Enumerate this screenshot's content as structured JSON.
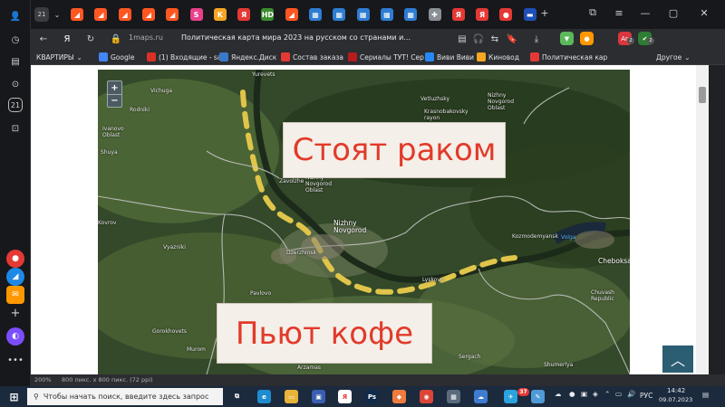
{
  "tabstrip": {
    "profile_counter": "21",
    "tabs": [
      {
        "icon": "yandex-zen-icon",
        "color": "#ff5722",
        "glyph": "◢"
      },
      {
        "icon": "yandex-zen-icon",
        "color": "#ff5722",
        "glyph": "◢"
      },
      {
        "icon": "yandex-zen-icon",
        "color": "#ff5722",
        "glyph": "◢"
      },
      {
        "icon": "yandex-zen-icon",
        "color": "#ff5722",
        "glyph": "◢"
      },
      {
        "icon": "yandex-zen-icon",
        "color": "#ff5722",
        "glyph": "◢"
      },
      {
        "icon": "s-site-icon",
        "color": "#e8418c",
        "glyph": "S"
      },
      {
        "icon": "kinovod-icon",
        "color": "#f5a623",
        "glyph": "K"
      },
      {
        "icon": "yandex-icon",
        "color": "#e53935",
        "glyph": "Я"
      },
      {
        "icon": "hd-site-icon",
        "color": "#3c8d2f",
        "glyph": "HD"
      },
      {
        "icon": "yandex-zen-icon",
        "color": "#ff5722",
        "glyph": "◢"
      },
      {
        "icon": "windows-icon",
        "color": "#2d7dd2",
        "glyph": "▦"
      },
      {
        "icon": "windows-icon",
        "color": "#2d7dd2",
        "glyph": "▦"
      },
      {
        "icon": "windows-icon",
        "color": "#2d7dd2",
        "glyph": "▦"
      },
      {
        "icon": "windows-icon",
        "color": "#2d7dd2",
        "glyph": "▦"
      },
      {
        "icon": "windows-icon",
        "color": "#2d7dd2",
        "glyph": "▦"
      },
      {
        "icon": "puzzle-icon",
        "color": "#8a8f96",
        "glyph": "✚"
      },
      {
        "icon": "yandex-icon",
        "color": "#e53935",
        "glyph": "Я"
      },
      {
        "icon": "yandex-icon",
        "color": "#e53935",
        "glyph": "Я"
      },
      {
        "icon": "map-pin-icon",
        "color": "#e53935",
        "glyph": "●"
      },
      {
        "icon": "russian-flag-icon",
        "color": "#1e4fb8",
        "glyph": "▬"
      }
    ]
  },
  "address": {
    "url": "1maps.ru",
    "title": "Политическая карта мира 2023 на русском со странами и..."
  },
  "extensions": [
    {
      "icon": "download-icon",
      "color": "#5cb85c",
      "label": "▼"
    },
    {
      "icon": "alice-apps-icon",
      "color": "#ff9800",
      "label": "●"
    },
    {
      "icon": "ag-badge-icon",
      "color": "#d9363e",
      "label": "Аг",
      "badge": "2"
    },
    {
      "icon": "shield-badge-icon",
      "color": "#2e7d32",
      "label": "✔",
      "badge": "2"
    }
  ],
  "bookmarks": [
    {
      "label": "КВАРТИРЫ",
      "icon": "folder-icon",
      "color": "",
      "chev": true
    },
    {
      "label": "Google",
      "icon": "google-icon",
      "color": "#4285f4",
      "chev": false
    },
    {
      "label": "(1) Входящие - sa",
      "icon": "gmail-icon",
      "color": "#d93025",
      "chev": false
    },
    {
      "label": "Яндекс.Диск",
      "icon": "yandex-disk-icon",
      "color": "#3a78c9",
      "chev": false
    },
    {
      "label": "Состав заказа",
      "icon": "order-icon",
      "color": "#e53935",
      "chev": false
    },
    {
      "label": "Сериалы ТУТ! Сер",
      "icon": "serials-icon",
      "color": "#b71c1c",
      "chev": false
    },
    {
      "label": "Виви Виви",
      "icon": "vk-icon",
      "color": "#2787f5",
      "chev": false
    },
    {
      "label": "Киновод",
      "icon": "kinovod-icon",
      "color": "#f5a623",
      "chev": false
    },
    {
      "label": "Политическая кар",
      "icon": "maps-icon",
      "color": "#e53935",
      "chev": false
    },
    {
      "label": "Другое",
      "icon": "folder-icon",
      "color": "",
      "chev": true
    }
  ],
  "map": {
    "overlay_top": "Стоят раком",
    "overlay_bottom": "Пьют кофе",
    "zoom_in": "+",
    "zoom_out": "−",
    "labels": {
      "yurevets": "Yurevets",
      "vichuga": "Vichuga",
      "rodniki": "Rodniki",
      "ivanovo": "Ivanovo Oblast",
      "shuya": "Shuya",
      "vetluzhsky": "Vetluzhsky",
      "krasnobakovsky": "Krasnobakovsky rayon",
      "nno_top": "Nizhny Novgorod Oblast",
      "nno_mid": "Nizhny Novgorod Oblast",
      "zavolzhye": "Zavolzhe",
      "kovrov": "Kovrov",
      "vyazniki": "Vyazniki",
      "nizhny": "Nizhny Novgorod",
      "dzerzhinsk": "Dzerzhinsk",
      "kozmodemyansk": "Kozmodemyansk",
      "volga": "Volga",
      "cheboksary": "Cheboksar",
      "chuvash": "Chuvash Republic",
      "lyskovo": "Lyskovo",
      "pavlovo": "Pavlovo",
      "gorokhovets": "Gorokhovets",
      "murom": "Murom",
      "sergach": "Sergach",
      "shumerlya": "Shumerlya",
      "arzamas": "Arzamas"
    }
  },
  "statusbar": {
    "zoom": "200%",
    "dims": "800 пикс. x 800 пикс. (72 ppi)"
  },
  "taskbar": {
    "search_placeholder": "Чтобы начать поиск, введите здесь запрос",
    "lang": "РУС",
    "time": "14:42",
    "date": "09.07.2023",
    "telegram_badge": "37",
    "apps": [
      {
        "icon": "task-view-icon",
        "color": "#1c2a3d",
        "label": "⧉"
      },
      {
        "icon": "edge-icon",
        "color": "#1f8ccf",
        "label": "e"
      },
      {
        "icon": "file-explorer-icon",
        "color": "#e8b339",
        "label": "▭"
      },
      {
        "icon": "store-icon",
        "color": "#3a5fb0",
        "label": "▣"
      },
      {
        "icon": "yandex-browser-icon",
        "color": "#ffffff",
        "label": "Я"
      },
      {
        "icon": "photoshop-icon",
        "color": "#0f2a4a",
        "label": "Ps"
      },
      {
        "icon": "app-orange-icon",
        "color": "#f07b3f",
        "label": "◆"
      },
      {
        "icon": "chrome-icon",
        "color": "#db4437",
        "label": "◉"
      },
      {
        "icon": "tiles-icon",
        "color": "#5a6b7d",
        "label": "▦"
      },
      {
        "icon": "cloud-app-icon",
        "color": "#3e7bd1",
        "label": "☁"
      },
      {
        "icon": "telegram-icon",
        "color": "#2aa3df",
        "label": "✈"
      },
      {
        "icon": "notepad-icon",
        "color": "#4f9ad6",
        "label": "✎"
      }
    ]
  }
}
